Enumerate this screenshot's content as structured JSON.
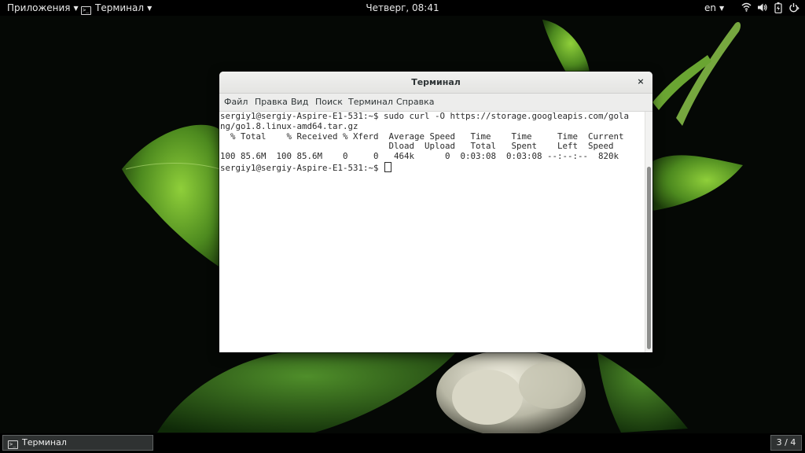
{
  "topbar": {
    "applications_label": "Приложения",
    "app_menu_label": "Терминал",
    "clock": "Четверг, 08:41",
    "language": "en",
    "tray_icons": [
      "wifi-icon",
      "volume-icon",
      "battery-icon",
      "power-icon"
    ]
  },
  "window": {
    "title": "Терминал",
    "close_glyph": "×",
    "menu": [
      "Файл",
      "Правка",
      "Вид",
      "Поиск",
      "Терминал",
      "Справка"
    ]
  },
  "terminal": {
    "lines": [
      "sergiy1@sergiy-Aspire-E1-531:~$ sudo curl -O https://storage.googleapis.com/gola",
      "ng/go1.8.linux-amd64.tar.gz",
      "  % Total    % Received % Xferd  Average Speed   Time    Time     Time  Current",
      "                                 Dload  Upload   Total   Spent    Left  Speed",
      "100 85.6M  100 85.6M    0     0   464k      0  0:03:08  0:03:08 --:--:--  820k"
    ],
    "prompt": "sergiy1@sergiy-Aspire-E1-531:~$ "
  },
  "taskbar": {
    "window_button_label": "Терминал",
    "workspace": "3 / 4"
  },
  "colors": {
    "panel": "#000000",
    "window_bg": "#ffffff",
    "leaf_green": "#5a9a2a",
    "flower": "#e8e6d8"
  }
}
